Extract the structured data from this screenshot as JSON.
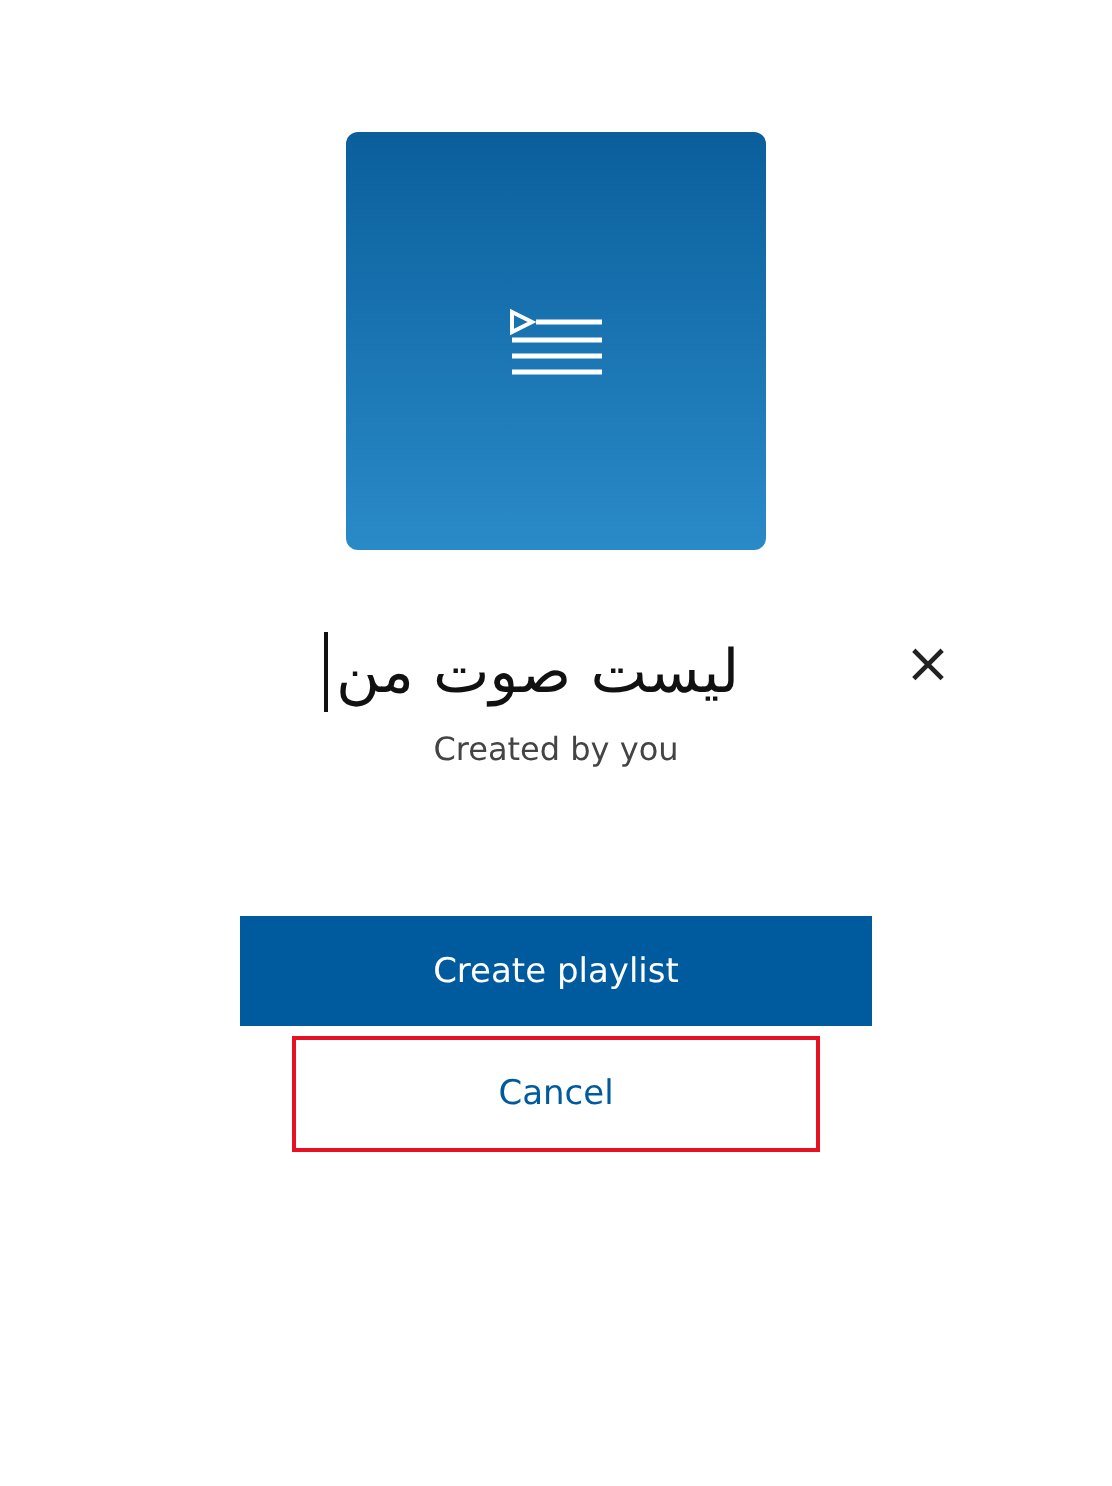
{
  "playlist_name": {
    "value": "لیست صوت من",
    "focused": true
  },
  "clear_button": {
    "label": "×"
  },
  "subtitle": "Created by you",
  "buttons": [
    {
      "label": "Create playlist",
      "kind": "primary",
      "highlighted": false
    },
    {
      "label": "Cancel",
      "kind": "secondary",
      "highlighted": true
    }
  ]
}
